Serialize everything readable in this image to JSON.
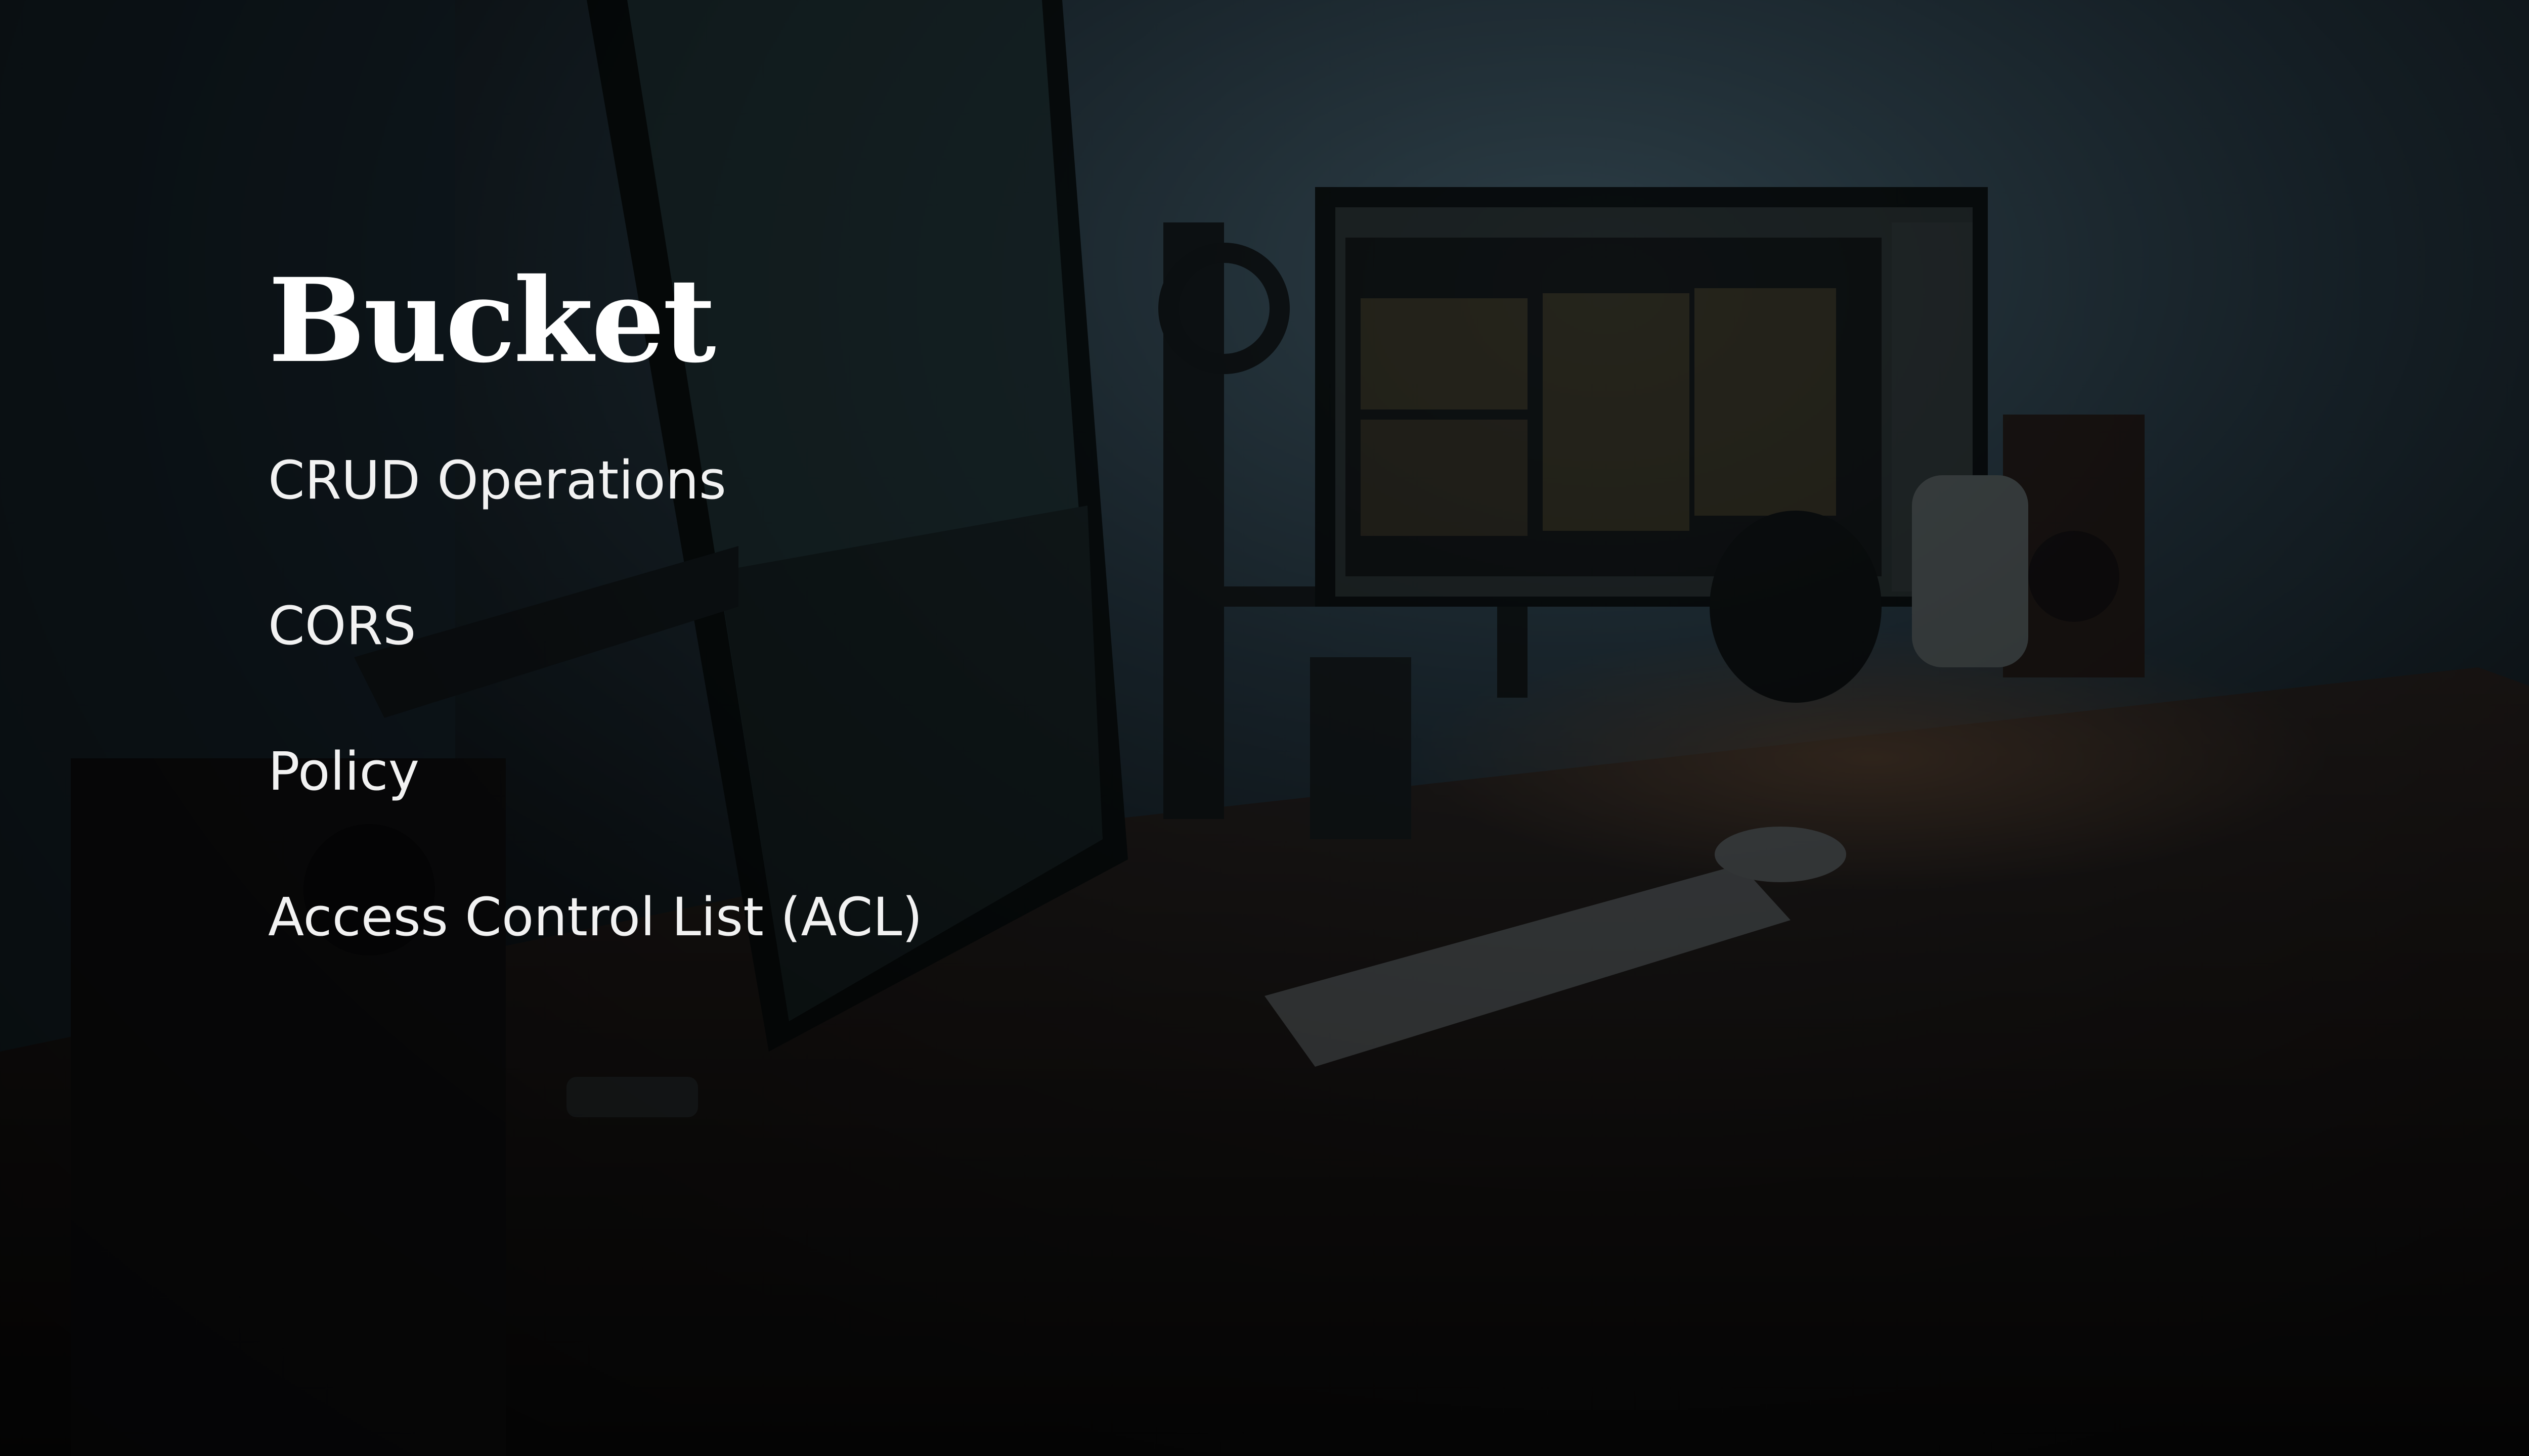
{
  "slide": {
    "title": "Bucket",
    "items": [
      {
        "label": "CRUD Operations"
      },
      {
        "label": "CORS"
      },
      {
        "label": "Policy"
      },
      {
        "label": "Access Control List (ACL)"
      }
    ]
  },
  "colors": {
    "background": "#0b1014",
    "text": "#ffffff",
    "desk_glow": "#2a1c12",
    "wall": "#1f2a30"
  },
  "background_image": {
    "icon": "desk-setup-photo"
  }
}
